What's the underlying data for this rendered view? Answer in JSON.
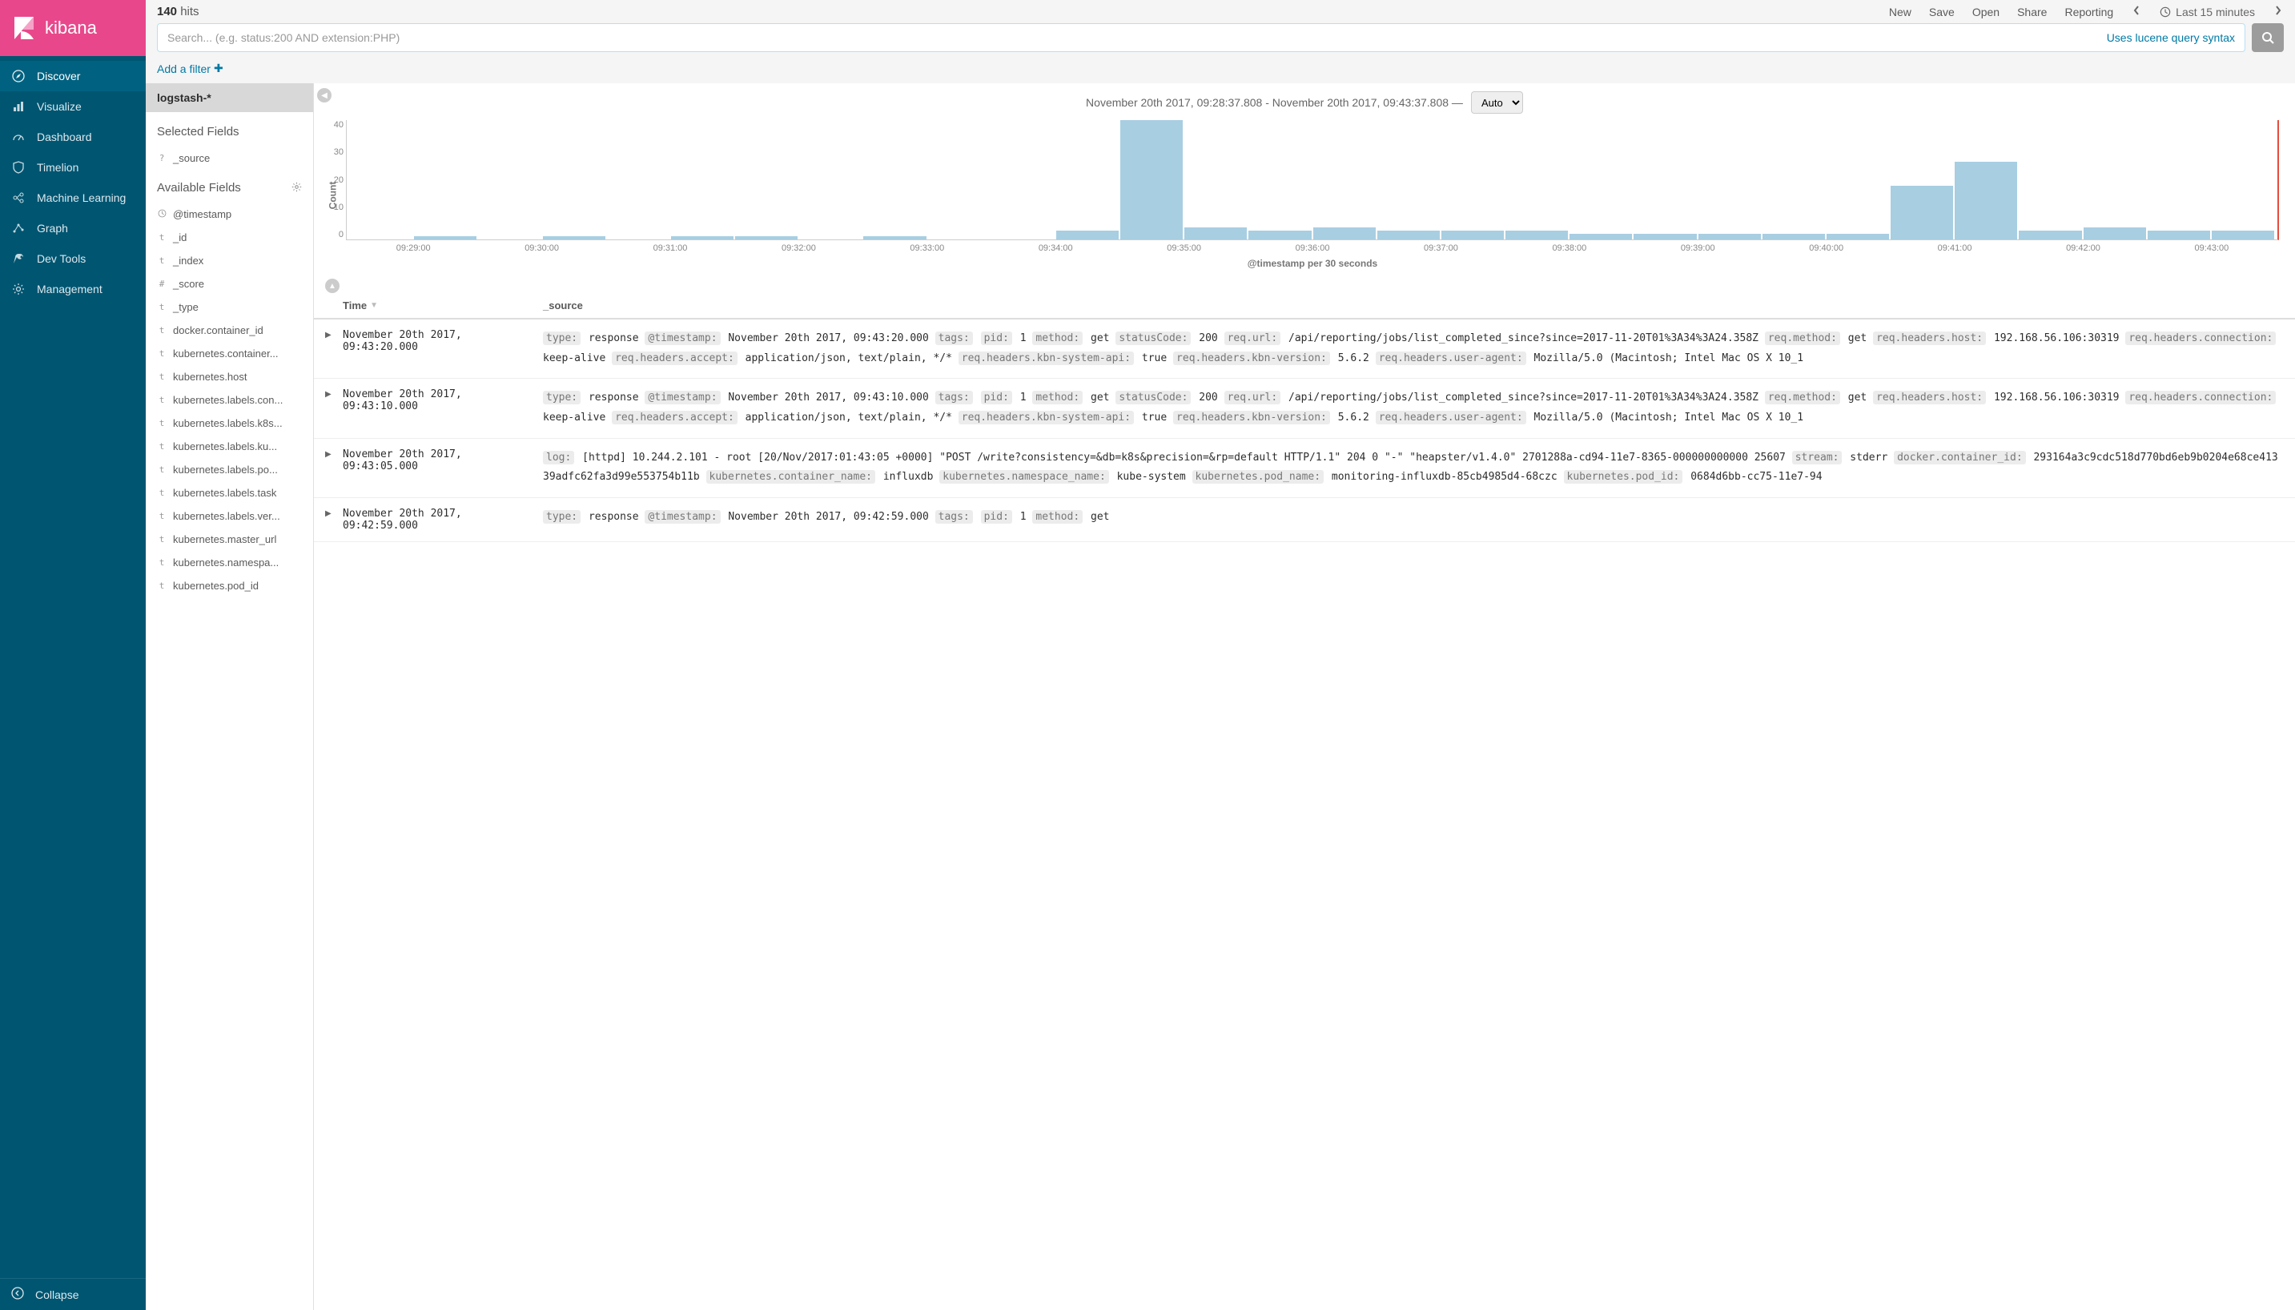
{
  "brand": {
    "name": "kibana"
  },
  "nav": {
    "items": [
      {
        "label": "Discover",
        "icon": "compass",
        "active": true
      },
      {
        "label": "Visualize",
        "icon": "bar-chart",
        "active": false
      },
      {
        "label": "Dashboard",
        "icon": "gauge",
        "active": false
      },
      {
        "label": "Timelion",
        "icon": "shield",
        "active": false
      },
      {
        "label": "Machine Learning",
        "icon": "ml",
        "active": false
      },
      {
        "label": "Graph",
        "icon": "graph",
        "active": false
      },
      {
        "label": "Dev Tools",
        "icon": "wrench",
        "active": false
      },
      {
        "label": "Management",
        "icon": "gear",
        "active": false
      }
    ],
    "collapse_label": "Collapse"
  },
  "topbar": {
    "hits_count": "140",
    "hits_label": "hits",
    "actions": [
      "New",
      "Save",
      "Open",
      "Share",
      "Reporting"
    ],
    "time_label": "Last 15 minutes",
    "search_placeholder": "Search... (e.g. status:200 AND extension:PHP)",
    "lucene_link": "Uses lucene query syntax",
    "add_filter_label": "Add a filter"
  },
  "fields": {
    "index_pattern": "logstash-*",
    "selected_title": "Selected Fields",
    "selected": [
      {
        "type": "?",
        "name": "_source"
      }
    ],
    "available_title": "Available Fields",
    "available": [
      {
        "type": "clock",
        "name": "@timestamp"
      },
      {
        "type": "t",
        "name": "_id"
      },
      {
        "type": "t",
        "name": "_index"
      },
      {
        "type": "#",
        "name": "_score"
      },
      {
        "type": "t",
        "name": "_type"
      },
      {
        "type": "t",
        "name": "docker.container_id"
      },
      {
        "type": "t",
        "name": "kubernetes.container..."
      },
      {
        "type": "t",
        "name": "kubernetes.host"
      },
      {
        "type": "t",
        "name": "kubernetes.labels.con..."
      },
      {
        "type": "t",
        "name": "kubernetes.labels.k8s..."
      },
      {
        "type": "t",
        "name": "kubernetes.labels.ku..."
      },
      {
        "type": "t",
        "name": "kubernetes.labels.po..."
      },
      {
        "type": "t",
        "name": "kubernetes.labels.task"
      },
      {
        "type": "t",
        "name": "kubernetes.labels.ver..."
      },
      {
        "type": "t",
        "name": "kubernetes.master_url"
      },
      {
        "type": "t",
        "name": "kubernetes.namespa..."
      },
      {
        "type": "t",
        "name": "kubernetes.pod_id"
      }
    ]
  },
  "chart_header": {
    "range_text": "November 20th 2017, 09:28:37.808 - November 20th 2017, 09:43:37.808 —",
    "interval_value": "Auto"
  },
  "chart_data": {
    "type": "bar",
    "ylabel": "Count",
    "xlabel": "@timestamp per 30 seconds",
    "ylim": [
      0,
      40
    ],
    "yticks": [
      40,
      30,
      20,
      10,
      0
    ],
    "xticks": [
      "09:29:00",
      "09:30:00",
      "09:31:00",
      "09:32:00",
      "09:33:00",
      "09:34:00",
      "09:35:00",
      "09:36:00",
      "09:37:00",
      "09:38:00",
      "09:39:00",
      "09:40:00",
      "09:41:00",
      "09:42:00",
      "09:43:00"
    ],
    "values": [
      0,
      1,
      0,
      1,
      0,
      1,
      1,
      0,
      1,
      0,
      0,
      3,
      40,
      4,
      3,
      4,
      3,
      3,
      3,
      2,
      2,
      2,
      2,
      2,
      18,
      26,
      3,
      4,
      3,
      3
    ]
  },
  "table": {
    "headers": {
      "time": "Time",
      "source": "_source"
    },
    "rows": [
      {
        "time": "November 20th 2017, 09:43:20.000",
        "kv": [
          [
            "type:",
            "response"
          ],
          [
            "@timestamp:",
            "November 20th 2017, 09:43:20.000"
          ],
          [
            "tags:",
            ""
          ],
          [
            "pid:",
            "1"
          ],
          [
            "method:",
            "get"
          ],
          [
            "statusCode:",
            "200"
          ],
          [
            "req.url:",
            "/api/reporting/jobs/list_completed_since?since=2017-11-20T01%3A34%3A24.358Z"
          ],
          [
            "req.method:",
            "get"
          ],
          [
            "req.headers.host:",
            "192.168.56.106:30319"
          ],
          [
            "req.headers.connection:",
            "keep-alive"
          ],
          [
            "req.headers.accept:",
            "application/json, text/plain, */*"
          ],
          [
            "req.headers.kbn-system-api:",
            "true"
          ],
          [
            "req.headers.kbn-version:",
            "5.6.2"
          ],
          [
            "req.headers.user-agent:",
            "Mozilla/5.0 (Macintosh; Intel Mac OS X 10_1"
          ]
        ]
      },
      {
        "time": "November 20th 2017, 09:43:10.000",
        "kv": [
          [
            "type:",
            "response"
          ],
          [
            "@timestamp:",
            "November 20th 2017, 09:43:10.000"
          ],
          [
            "tags:",
            ""
          ],
          [
            "pid:",
            "1"
          ],
          [
            "method:",
            "get"
          ],
          [
            "statusCode:",
            "200"
          ],
          [
            "req.url:",
            "/api/reporting/jobs/list_completed_since?since=2017-11-20T01%3A34%3A24.358Z"
          ],
          [
            "req.method:",
            "get"
          ],
          [
            "req.headers.host:",
            "192.168.56.106:30319"
          ],
          [
            "req.headers.connection:",
            "keep-alive"
          ],
          [
            "req.headers.accept:",
            "application/json, text/plain, */*"
          ],
          [
            "req.headers.kbn-system-api:",
            "true"
          ],
          [
            "req.headers.kbn-version:",
            "5.6.2"
          ],
          [
            "req.headers.user-agent:",
            "Mozilla/5.0 (Macintosh; Intel Mac OS X 10_1"
          ]
        ]
      },
      {
        "time": "November 20th 2017, 09:43:05.000",
        "kv": [
          [
            "log:",
            "[httpd] 10.244.2.101 - root [20/Nov/2017:01:43:05 +0000] \"POST /write?consistency=&db=k8s&precision=&rp=default HTTP/1.1\" 204 0 \"-\" \"heapster/v1.4.0\" 2701288a-cd94-11e7-8365-000000000000 25607"
          ],
          [
            "stream:",
            "stderr"
          ],
          [
            "docker.container_id:",
            "293164a3c9cdc518d770bd6eb9b0204e68ce41339adfc62fa3d99e553754b11b"
          ],
          [
            "kubernetes.container_name:",
            "influxdb"
          ],
          [
            "kubernetes.namespace_name:",
            "kube-system"
          ],
          [
            "kubernetes.pod_name:",
            "monitoring-influxdb-85cb4985d4-68czc"
          ],
          [
            "kubernetes.pod_id:",
            "0684d6bb-cc75-11e7-94"
          ]
        ]
      },
      {
        "time": "November 20th 2017, 09:42:59.000",
        "kv": [
          [
            "type:",
            "response"
          ],
          [
            "@timestamp:",
            "November 20th 2017, 09:42:59.000"
          ],
          [
            "tags:",
            ""
          ],
          [
            "pid:",
            "1"
          ],
          [
            "method:",
            "get"
          ]
        ]
      }
    ]
  }
}
